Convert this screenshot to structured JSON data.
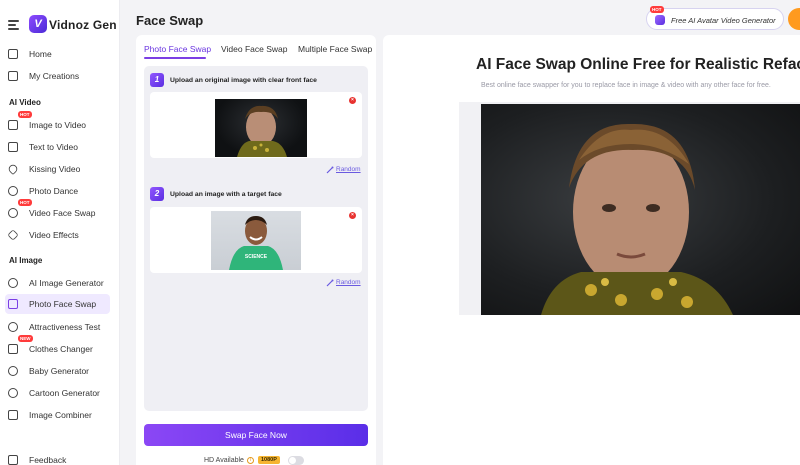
{
  "brand": {
    "name": "Vidnoz Gen",
    "logo_letter": "V"
  },
  "header": {
    "title": "Face Swap",
    "promo": {
      "badge": "HOT",
      "label": "Free AI Avatar Video Generator"
    }
  },
  "sidebar": {
    "top_items": [
      {
        "label": "Home",
        "icon": "home-icon"
      },
      {
        "label": "My Creations",
        "icon": "folder-icon"
      }
    ],
    "sections": [
      {
        "title": "AI Video",
        "items": [
          {
            "label": "Image to Video",
            "icon": "image-video-icon",
            "badge": "HOT"
          },
          {
            "label": "Text to Video",
            "icon": "text-video-icon"
          },
          {
            "label": "Kissing Video",
            "icon": "heart-icon"
          },
          {
            "label": "Photo Dance",
            "icon": "dance-icon"
          },
          {
            "label": "Video Face Swap",
            "icon": "video-swap-icon",
            "badge": "HOT"
          },
          {
            "label": "Video Effects",
            "icon": "sparkle-icon"
          }
        ]
      },
      {
        "title": "AI Image",
        "items": [
          {
            "label": "AI Image Generator",
            "icon": "image-gen-icon"
          },
          {
            "label": "Photo Face Swap",
            "icon": "face-swap-icon",
            "active": true
          },
          {
            "label": "Attractiveness Test",
            "icon": "face-test-icon"
          },
          {
            "label": "Clothes Changer",
            "icon": "shirt-icon",
            "badge": "NEW"
          },
          {
            "label": "Baby Generator",
            "icon": "baby-icon"
          },
          {
            "label": "Cartoon Generator",
            "icon": "cartoon-icon"
          },
          {
            "label": "Image Combiner",
            "icon": "combine-icon"
          }
        ]
      }
    ],
    "bottom_item": {
      "label": "Feedback",
      "icon": "feedback-icon"
    }
  },
  "panel": {
    "tabs": [
      {
        "label": "Photo Face Swap",
        "active": true
      },
      {
        "label": "Video Face Swap"
      },
      {
        "label": "Multiple Face Swap"
      }
    ],
    "steps": [
      {
        "number": "1",
        "label": "Upload an original image with clear front face",
        "random": "Random"
      },
      {
        "number": "2",
        "label": "Upload an image with a target face",
        "random": "Random"
      }
    ],
    "swap_button": "Swap Face Now",
    "hd": {
      "label": "HD Available",
      "badge": "1080P",
      "enabled": false
    }
  },
  "preview": {
    "title": "AI Face Swap Online Free for Realistic Refacing",
    "subtitle": "Best online face swapper for you to replace face in image & video with any other face for free."
  },
  "colors": {
    "accent": "#7b3fe4",
    "hot_badge": "#ff3b3b",
    "remove": "#e8322f",
    "hd_badge": "#f6b531"
  }
}
